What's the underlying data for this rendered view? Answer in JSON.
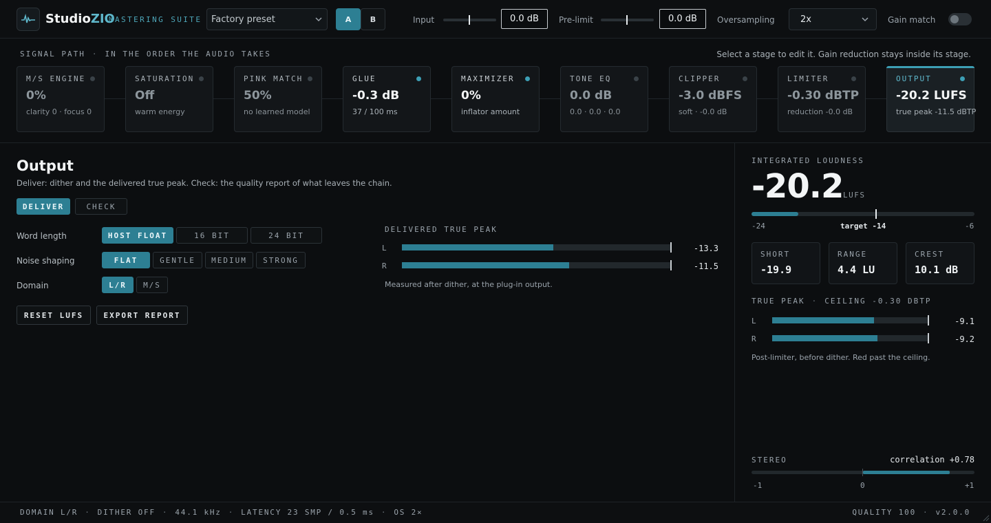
{
  "topbar": {
    "brand_main": "Studio",
    "brand_accent": "ZIO",
    "brand_sub": "MASTERING SUITE",
    "preset": "Factory preset",
    "ab_a": "A",
    "ab_b": "B",
    "input_label": "Input",
    "input_value": "0.0 dB",
    "prelimit_label": "Pre-limit",
    "prelimit_value": "0.0 dB",
    "oversampling_label": "Oversampling",
    "oversampling_value": "2x",
    "gain_match_label": "Gain match",
    "gain_match_on": false
  },
  "signal_path": {
    "title": "SIGNAL PATH",
    "subtitle": "IN THE ORDER THE AUDIO TAKES",
    "hint": "Select a stage to edit it. Gain reduction stays inside its stage.",
    "stages": [
      {
        "name": "M/S ENGINE",
        "value": "0%",
        "sub": "clarity 0 · focus 0"
      },
      {
        "name": "SATURATION",
        "value": "Off",
        "sub": "warm energy"
      },
      {
        "name": "PINK MATCH",
        "value": "50%",
        "sub": "no learned model"
      },
      {
        "name": "GLUE",
        "value": "-0.3 dB",
        "sub": "37 / 100 ms"
      },
      {
        "name": "MAXIMIZER",
        "value": "0%",
        "sub": "inflator amount"
      },
      {
        "name": "TONE EQ",
        "value": "0.0 dB",
        "sub": "0.0 · 0.0 · 0.0"
      },
      {
        "name": "CLIPPER",
        "value": "-3.0 dBFS",
        "sub": "soft · -0.0 dB"
      },
      {
        "name": "LIMITER",
        "value": "-0.30 dBTP",
        "sub": "reduction -0.0 dB"
      },
      {
        "name": "OUTPUT",
        "value": "-20.2 LUFS",
        "sub": "true peak -11.5 dBTP"
      }
    ]
  },
  "main": {
    "title": "Output",
    "description": "Deliver: dither and the delivered true peak. Check: the quality report of what leaves the chain.",
    "tab_deliver": "DELIVER",
    "tab_check": "CHECK",
    "word_length_label": "Word length",
    "word_length": [
      "HOST FLOAT",
      "16 BIT",
      "24 BIT"
    ],
    "noise_shaping_label": "Noise shaping",
    "noise_shaping": [
      "FLAT",
      "GENTLE",
      "MEDIUM",
      "STRONG"
    ],
    "domain_label": "Domain",
    "domain": [
      "L/R",
      "M/S"
    ],
    "reset_button": "RESET LUFS",
    "export_button": "EXPORT REPORT",
    "dtp_title": "DELIVERED TRUE PEAK",
    "dtp_left_label": "L",
    "dtp_left_value": "-13.3",
    "dtp_left_fill": 0.56,
    "dtp_right_label": "R",
    "dtp_right_value": "-11.5",
    "dtp_right_fill": 0.62,
    "dtp_note": "Measured after dither, at the plug-in output."
  },
  "loudness": {
    "title": "INTEGRATED LOUDNESS",
    "value": "-20.2",
    "unit": "LUFS",
    "scale_min": "-24",
    "scale_target": "target -14",
    "scale_max": "-6",
    "fill_fraction": 0.21,
    "target_fraction": 0.555,
    "short_label": "SHORT",
    "short_value": "-19.9",
    "range_label": "RANGE",
    "range_value": "4.4 LU",
    "crest_label": "CREST",
    "crest_value": "10.1 dB",
    "tp_title": "TRUE PEAK",
    "tp_ceiling": "CEILING -0.30 dBTP",
    "tp_left_label": "L",
    "tp_left_value": "-9.1",
    "tp_left_fill": 0.65,
    "tp_right_label": "R",
    "tp_right_value": "-9.2",
    "tp_right_fill": 0.67,
    "tp_note": "Post-limiter, before dither. Red past the ceiling.",
    "stereo_title": "STEREO",
    "correlation": "correlation +0.78",
    "corr_value": 0.78,
    "corr_min": "-1",
    "corr_mid": "0",
    "corr_max": "+1"
  },
  "footer": {
    "left": [
      "DOMAIN L/R",
      "DITHER OFF",
      "44.1 kHz",
      "LATENCY 23 SMP / 0.5 ms",
      "OS 2×"
    ],
    "right": [
      "QUALITY 100",
      "v2.0.0"
    ]
  },
  "colors": {
    "accent": "#2d7f93",
    "accent_light": "#5fb8cc",
    "background": "#0c0e10"
  }
}
